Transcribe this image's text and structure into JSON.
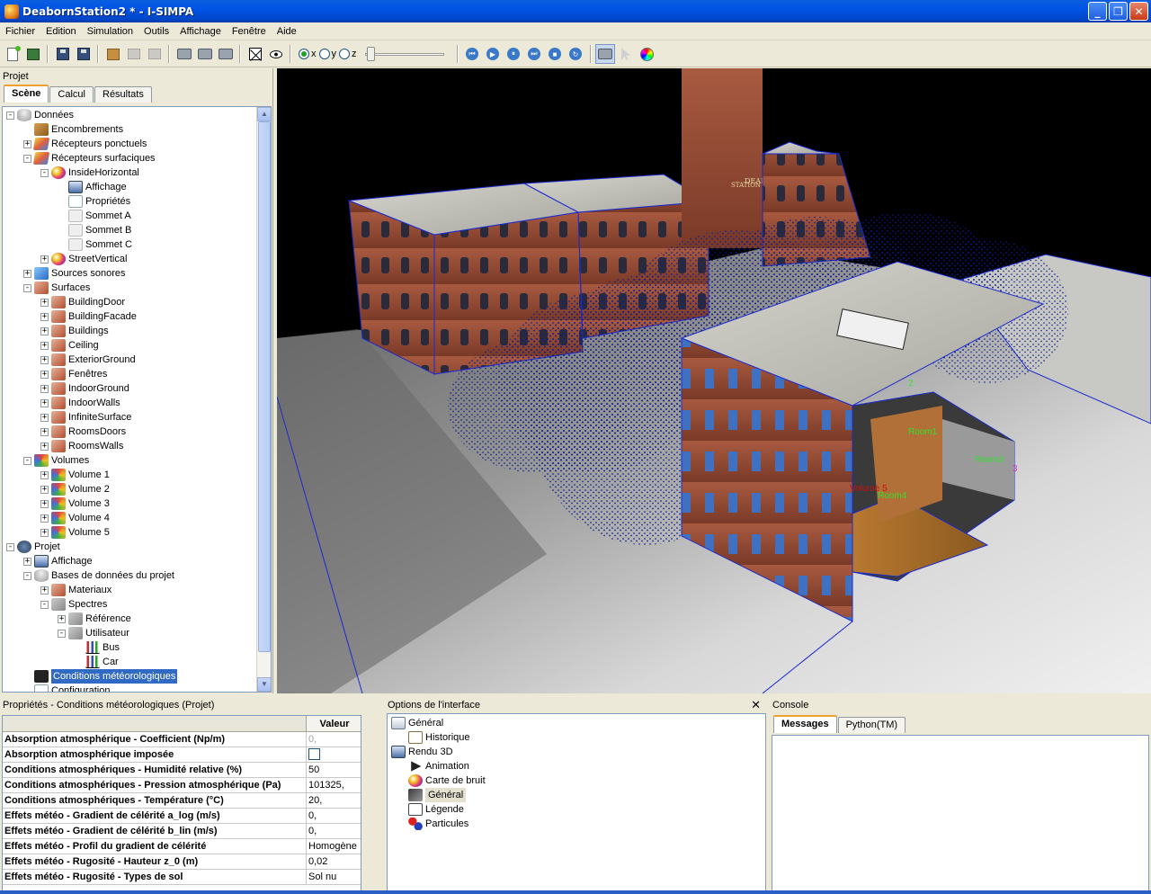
{
  "window": {
    "title": "DeabornStation2 * - I-SIMPA",
    "buttons": [
      "_",
      "❐",
      "✕"
    ]
  },
  "menu": [
    "Fichier",
    "Edition",
    "Simulation",
    "Outils",
    "Affichage",
    "Fenêtre",
    "Aide"
  ],
  "toolbar": {
    "axis_labels": {
      "x": "x",
      "y": "y",
      "z": "z"
    },
    "selected_axis": "x",
    "slice_slider_fraction": 0.0
  },
  "project_pane": {
    "title": "Projet",
    "tabs": [
      "Scène",
      "Calcul",
      "Résultats"
    ],
    "active_tab": "Scène",
    "tree": [
      {
        "label": "Données",
        "level": 0,
        "exp": "-",
        "icon": "i-db",
        "icon_name": "database-icon"
      },
      {
        "label": "Encombrements",
        "level": 1,
        "exp": "",
        "icon": "i-box",
        "icon_name": "box-icon"
      },
      {
        "label": "Récepteurs ponctuels",
        "level": 1,
        "exp": "+",
        "icon": "i-rec",
        "icon_name": "receiver-icon"
      },
      {
        "label": "Récepteurs surfaciques",
        "level": 1,
        "exp": "-",
        "icon": "i-rec",
        "icon_name": "surface-receiver-icon"
      },
      {
        "label": "InsideHorizontal",
        "level": 2,
        "exp": "-",
        "icon": "i-sphere",
        "icon_name": "color-sphere-icon"
      },
      {
        "label": "Affichage",
        "level": 3,
        "exp": "",
        "icon": "i-aff",
        "icon_name": "display-icon"
      },
      {
        "label": "Propriétés",
        "level": 3,
        "exp": "",
        "icon": "i-props",
        "icon_name": "properties-icon"
      },
      {
        "label": "Sommet A",
        "level": 3,
        "exp": "",
        "icon": "i-vert",
        "icon_name": "vertex-icon"
      },
      {
        "label": "Sommet B",
        "level": 3,
        "exp": "",
        "icon": "i-vert",
        "icon_name": "vertex-icon"
      },
      {
        "label": "Sommet C",
        "level": 3,
        "exp": "",
        "icon": "i-vert",
        "icon_name": "vertex-icon"
      },
      {
        "label": "StreetVertical",
        "level": 2,
        "exp": "+",
        "icon": "i-sphere",
        "icon_name": "color-sphere-icon"
      },
      {
        "label": "Sources sonores",
        "level": 1,
        "exp": "+",
        "icon": "i-src",
        "icon_name": "sound-source-icon"
      },
      {
        "label": "Surfaces",
        "level": 1,
        "exp": "-",
        "icon": "i-surf",
        "icon_name": "surfaces-icon"
      },
      {
        "label": "BuildingDoor",
        "level": 2,
        "exp": "+",
        "icon": "i-surf",
        "icon_name": "surface-group-icon"
      },
      {
        "label": "BuildingFacade",
        "level": 2,
        "exp": "+",
        "icon": "i-surf",
        "icon_name": "surface-group-icon"
      },
      {
        "label": "Buildings",
        "level": 2,
        "exp": "+",
        "icon": "i-surf",
        "icon_name": "surface-group-icon"
      },
      {
        "label": "Ceiling",
        "level": 2,
        "exp": "+",
        "icon": "i-surf",
        "icon_name": "surface-group-icon"
      },
      {
        "label": "ExteriorGround",
        "level": 2,
        "exp": "+",
        "icon": "i-surf",
        "icon_name": "surface-group-icon"
      },
      {
        "label": "Fenêtres",
        "level": 2,
        "exp": "+",
        "icon": "i-surf",
        "icon_name": "surface-group-icon"
      },
      {
        "label": "IndoorGround",
        "level": 2,
        "exp": "+",
        "icon": "i-surf",
        "icon_name": "surface-group-icon"
      },
      {
        "label": "IndoorWalls",
        "level": 2,
        "exp": "+",
        "icon": "i-surf",
        "icon_name": "surface-group-icon"
      },
      {
        "label": "InfiniteSurface",
        "level": 2,
        "exp": "+",
        "icon": "i-surf",
        "icon_name": "surface-group-icon"
      },
      {
        "label": "RoomsDoors",
        "level": 2,
        "exp": "+",
        "icon": "i-surf",
        "icon_name": "surface-group-icon"
      },
      {
        "label": "RoomsWalls",
        "level": 2,
        "exp": "+",
        "icon": "i-surf",
        "icon_name": "surface-group-icon"
      },
      {
        "label": "Volumes",
        "level": 1,
        "exp": "-",
        "icon": "i-vol",
        "icon_name": "volumes-icon"
      },
      {
        "label": "Volume 1",
        "level": 2,
        "exp": "+",
        "icon": "i-vol",
        "icon_name": "volume-icon"
      },
      {
        "label": "Volume 2",
        "level": 2,
        "exp": "+",
        "icon": "i-vol",
        "icon_name": "volume-icon"
      },
      {
        "label": "Volume 3",
        "level": 2,
        "exp": "+",
        "icon": "i-vol",
        "icon_name": "volume-icon"
      },
      {
        "label": "Volume 4",
        "level": 2,
        "exp": "+",
        "icon": "i-vol",
        "icon_name": "volume-icon"
      },
      {
        "label": "Volume 5",
        "level": 2,
        "exp": "+",
        "icon": "i-vol",
        "icon_name": "volume-icon"
      },
      {
        "label": "Projet",
        "level": 0,
        "exp": "-",
        "icon": "i-proj",
        "icon_name": "project-icon"
      },
      {
        "label": "Affichage",
        "level": 1,
        "exp": "+",
        "icon": "i-aff",
        "icon_name": "display-icon"
      },
      {
        "label": "Bases de données du projet",
        "level": 1,
        "exp": "-",
        "icon": "i-db",
        "icon_name": "database-icon"
      },
      {
        "label": "Materiaux",
        "level": 2,
        "exp": "+",
        "icon": "i-surf",
        "icon_name": "materials-icon"
      },
      {
        "label": "Spectres",
        "level": 2,
        "exp": "-",
        "icon": "i-spec",
        "icon_name": "spectrum-icon"
      },
      {
        "label": "Référence",
        "level": 3,
        "exp": "+",
        "icon": "i-spec",
        "icon_name": "spectrum-group-icon"
      },
      {
        "label": "Utilisateur",
        "level": 3,
        "exp": "-",
        "icon": "i-spec",
        "icon_name": "spectrum-group-icon"
      },
      {
        "label": "Bus",
        "level": 4,
        "exp": "",
        "icon": "i-chart",
        "icon_name": "chart-icon"
      },
      {
        "label": "Car",
        "level": 4,
        "exp": "",
        "icon": "i-chart",
        "icon_name": "chart-icon"
      },
      {
        "label": "Conditions météorologiques",
        "level": 1,
        "exp": "",
        "icon": "i-meteo",
        "icon_name": "meteo-icon",
        "selected": true
      },
      {
        "label": "Configuration",
        "level": 1,
        "exp": "",
        "icon": "i-props",
        "icon_name": "configuration-icon"
      }
    ]
  },
  "viewport": {
    "labels": [
      "Room1",
      "Room3",
      "Volume 5",
      "Room4",
      "3",
      "2"
    ]
  },
  "properties_pane": {
    "title": "Propriétés - Conditions météorologiques (Projet)",
    "value_header": "Valeur",
    "rows": [
      {
        "name": "Absorption atmosphérique - Coefficient (Np/m)",
        "value": "0,",
        "dim": true
      },
      {
        "name": "Absorption atmosphérique imposée",
        "value": "",
        "checkbox": true
      },
      {
        "name": "Conditions atmosphériques - Humidité relative (%)",
        "value": "50"
      },
      {
        "name": "Conditions atmosphériques - Pression atmosphérique (Pa)",
        "value": "101325,"
      },
      {
        "name": "Conditions atmosphériques - Température (°C)",
        "value": "20,"
      },
      {
        "name": "Effets météo - Gradient de célérité a_log (m/s)",
        "value": "0,"
      },
      {
        "name": "Effets météo - Gradient de célérité b_lin (m/s)",
        "value": "0,"
      },
      {
        "name": "Effets météo - Profil du gradient de célérité",
        "value": "Homogène"
      },
      {
        "name": "Effets météo - Rugosité - Hauteur z_0 (m)",
        "value": "0,02"
      },
      {
        "name": "Effets météo - Rugosité - Types de sol",
        "value": "Sol nu"
      }
    ]
  },
  "options_pane": {
    "title": "Options de l'interface",
    "close": "✕",
    "tree": [
      {
        "label": "Général",
        "level": 0,
        "icon": "i-gen",
        "icon_name": "general-icon"
      },
      {
        "label": "Historique",
        "level": 1,
        "icon": "i-hist",
        "icon_name": "history-icon"
      },
      {
        "label": "Rendu 3D",
        "level": 0,
        "icon": "i-aff",
        "icon_name": "render-3d-icon"
      },
      {
        "label": "Animation",
        "level": 1,
        "icon": "i-anim",
        "icon_name": "animation-icon"
      },
      {
        "label": "Carte de bruit",
        "level": 1,
        "icon": "i-sphere",
        "icon_name": "noise-map-icon"
      },
      {
        "label": "Général",
        "level": 1,
        "icon": "i-tool",
        "icon_name": "tools-icon",
        "selected": true
      },
      {
        "label": "Légende",
        "level": 1,
        "icon": "i-leg",
        "icon_name": "legend-icon"
      },
      {
        "label": "Particules",
        "level": 1,
        "icon": "i-part",
        "icon_name": "particles-icon"
      }
    ]
  },
  "console_pane": {
    "title": "Console",
    "tabs": [
      "Messages",
      "Python(TM)"
    ],
    "active_tab": "Messages"
  }
}
